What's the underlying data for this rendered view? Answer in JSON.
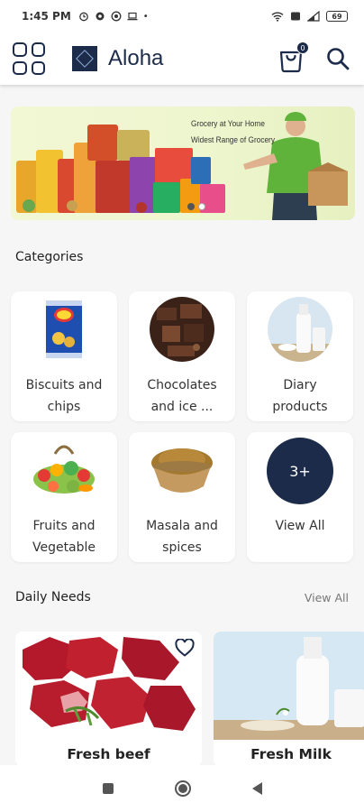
{
  "status_bar": {
    "time": "1:45 PM",
    "battery": "69"
  },
  "app_bar": {
    "title": "Aloha",
    "cart_count": "0"
  },
  "banner": {
    "line1": "Grocery at Your Home",
    "line2": "Widest Range of Grocery",
    "active_slide": 1,
    "slide_count": 2
  },
  "categories": {
    "title": "Categories",
    "items": [
      {
        "line1": "Biscuits and",
        "line2": "chips"
      },
      {
        "line1": "Chocolates",
        "line2": "and ice ..."
      },
      {
        "line1": "Diary",
        "line2": "products"
      },
      {
        "line1": "Fruits and",
        "line2": "Vegetable"
      },
      {
        "line1": "Masala and",
        "line2": "spices"
      },
      {
        "line1": "View All",
        "line2": ""
      }
    ],
    "view_all_badge": "3+"
  },
  "daily_needs": {
    "title": "Daily Needs",
    "view_all": "View All",
    "products": [
      {
        "name": "Fresh beef"
      },
      {
        "name": "Fresh Milk"
      }
    ]
  },
  "colors": {
    "brand_navy": "#1c2b4a",
    "background": "#f6f6f6"
  }
}
